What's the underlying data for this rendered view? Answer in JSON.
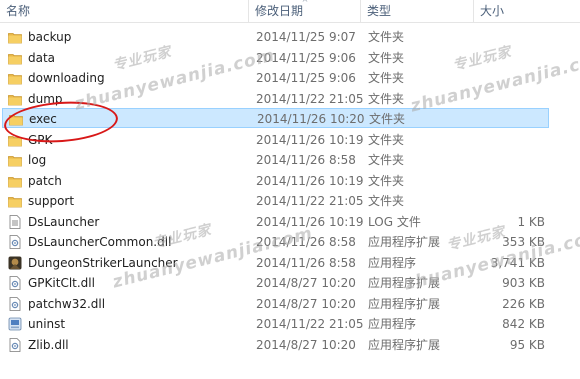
{
  "header": {
    "name_label": "名称",
    "date_label": "修改日期",
    "type_label": "类型",
    "size_label": "大小"
  },
  "files": [
    {
      "name": "backup",
      "date": "2014/11/25 9:07",
      "type": "文件夹",
      "size": "",
      "icon": "folder-icon"
    },
    {
      "name": "data",
      "date": "2014/11/25 9:06",
      "type": "文件夹",
      "size": "",
      "icon": "folder-icon"
    },
    {
      "name": "downloading",
      "date": "2014/11/25 9:06",
      "type": "文件夹",
      "size": "",
      "icon": "folder-icon"
    },
    {
      "name": "dump",
      "date": "2014/11/22 21:05",
      "type": "文件夹",
      "size": "",
      "icon": "folder-icon"
    },
    {
      "name": "exec",
      "date": "2014/11/26 10:20",
      "type": "文件夹",
      "size": "",
      "icon": "folder-icon",
      "selected": true
    },
    {
      "name": "GPK",
      "date": "2014/11/26 10:19",
      "type": "文件夹",
      "size": "",
      "icon": "folder-icon"
    },
    {
      "name": "log",
      "date": "2014/11/26 8:58",
      "type": "文件夹",
      "size": "",
      "icon": "folder-icon"
    },
    {
      "name": "patch",
      "date": "2014/11/26 10:19",
      "type": "文件夹",
      "size": "",
      "icon": "folder-icon"
    },
    {
      "name": "support",
      "date": "2014/11/22 21:05",
      "type": "文件夹",
      "size": "",
      "icon": "folder-icon"
    },
    {
      "name": "DsLauncher",
      "date": "2014/11/26 10:19",
      "type": "LOG 文件",
      "size": "1 KB",
      "icon": "text-file-icon"
    },
    {
      "name": "DsLauncherCommon.dll",
      "date": "2014/11/26 8:58",
      "type": "应用程序扩展",
      "size": "353 KB",
      "icon": "dll-file-icon"
    },
    {
      "name": "DungeonStrikerLauncher",
      "date": "2014/11/26 8:58",
      "type": "应用程序",
      "size": "3,741 KB",
      "icon": "game-app-icon"
    },
    {
      "name": "GPKitClt.dll",
      "date": "2014/8/27 10:20",
      "type": "应用程序扩展",
      "size": "903 KB",
      "icon": "dll-file-icon"
    },
    {
      "name": "patchw32.dll",
      "date": "2014/8/27 10:20",
      "type": "应用程序扩展",
      "size": "226 KB",
      "icon": "dll-file-icon"
    },
    {
      "name": "uninst",
      "date": "2014/11/22 21:05",
      "type": "应用程序",
      "size": "842 KB",
      "icon": "uninstaller-icon"
    },
    {
      "name": "Zlib.dll",
      "date": "2014/8/27 10:20",
      "type": "应用程序扩展",
      "size": "95 KB",
      "icon": "dll-file-icon"
    }
  ],
  "watermark": {
    "text_cn": "专业玩家",
    "text_en": "zhuanyewanjia.com"
  },
  "colors": {
    "selection_bg": "#cce8ff",
    "selection_border": "#99d1ff",
    "folder": "#e8b84a",
    "annotation_circle": "#d81818"
  }
}
